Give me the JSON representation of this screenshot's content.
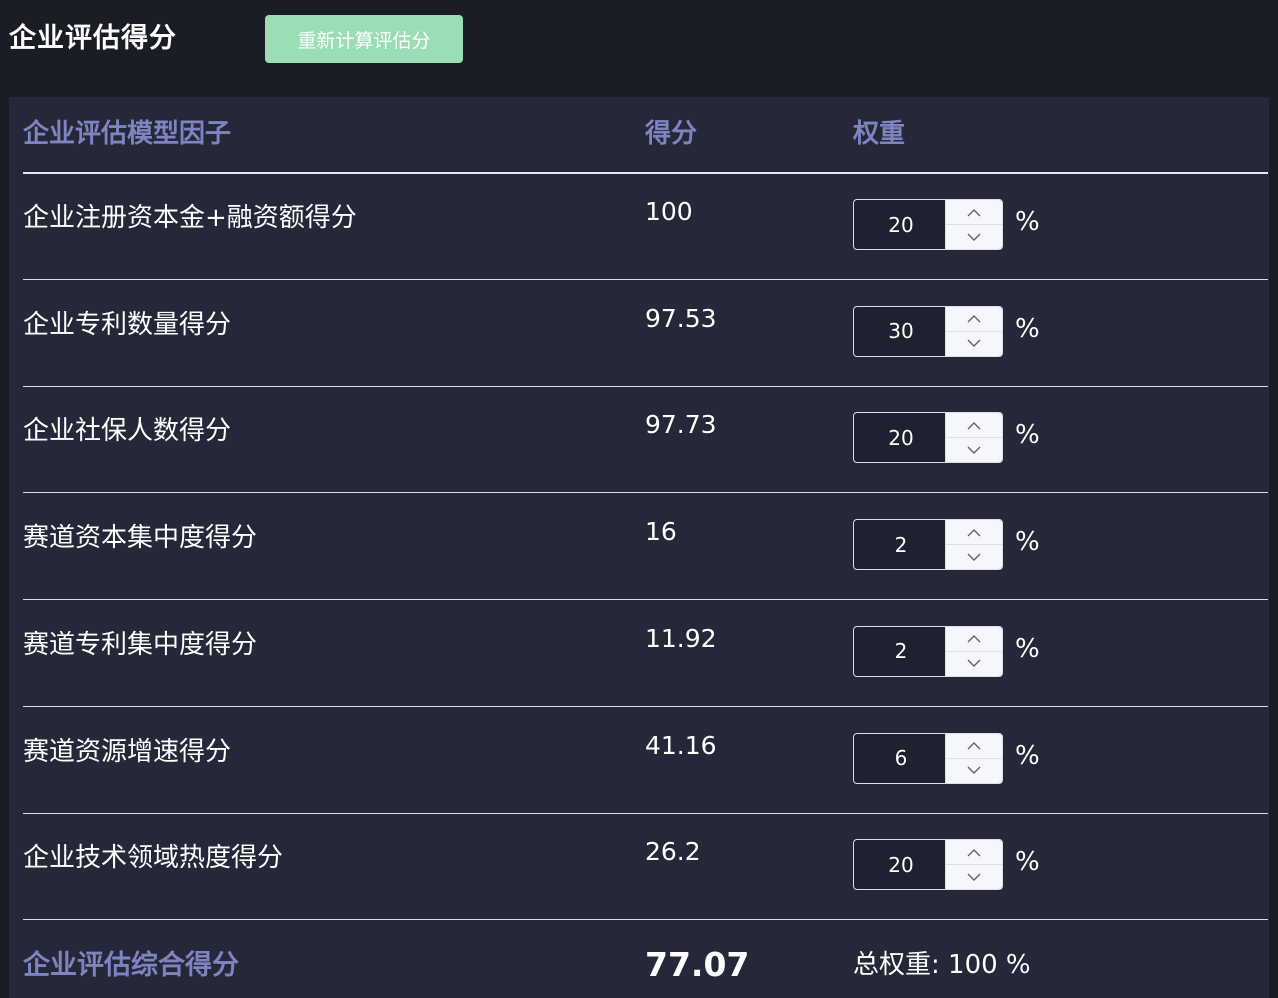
{
  "page": {
    "title": "企业评估得分",
    "recalculate_label": "重新计算评估分"
  },
  "table": {
    "headers": {
      "factor": "企业评估模型因子",
      "score": "得分",
      "weight": "权重"
    },
    "percent_sign": "%",
    "rows": [
      {
        "factor": "企业注册资本金+融资额得分",
        "score": "100",
        "weight": "20"
      },
      {
        "factor": "企业专利数量得分",
        "score": "97.53",
        "weight": "30"
      },
      {
        "factor": "企业社保人数得分",
        "score": "97.73",
        "weight": "20"
      },
      {
        "factor": "赛道资本集中度得分",
        "score": "16",
        "weight": "2"
      },
      {
        "factor": "赛道专利集中度得分",
        "score": "11.92",
        "weight": "2"
      },
      {
        "factor": "赛道资源增速得分",
        "score": "41.16",
        "weight": "6"
      },
      {
        "factor": "企业技术领域热度得分",
        "score": "26.2",
        "weight": "20"
      }
    ],
    "footer": {
      "label": "企业评估综合得分",
      "total_score": "77.07",
      "total_weight": "总权重: 100 %"
    }
  },
  "colors": {
    "background": "#1a1c26",
    "panel": "#252838",
    "header_text": "#7d84bf",
    "button": "#9bddb4"
  }
}
